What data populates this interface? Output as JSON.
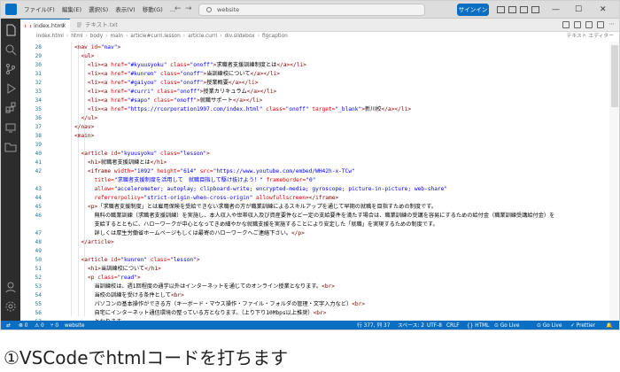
{
  "titlebar": {
    "menu": [
      "ファイル(F)",
      "編集(E)",
      "選択(S)",
      "表示(V)",
      "移動(G)",
      "…"
    ],
    "search_text": "website",
    "signin_label": "サインイン",
    "back_glyph": "←",
    "forward_glyph": "→",
    "minimize_glyph": "—",
    "maximize_glyph": "☐",
    "close_glyph": "✕"
  },
  "tabs": [
    {
      "label": "index.html",
      "close": "×",
      "active": true
    },
    {
      "label": "テキスト.txt",
      "active": false
    }
  ],
  "breadcrumb": {
    "items": [
      "index.html",
      "html",
      "body",
      "main",
      "article#curri.lesson",
      "article.curri",
      "div.slidebox",
      "figcaption"
    ],
    "right_label": "テキスト エディター"
  },
  "code_lines": [
    {
      "n": "28",
      "indent": 4,
      "segs": [
        [
          "tag",
          "<nav "
        ],
        [
          "attr",
          "id="
        ],
        [
          "val",
          "\"nav\""
        ],
        [
          "tag",
          ">"
        ]
      ]
    },
    {
      "n": "29",
      "indent": 6,
      "segs": [
        [
          "tag",
          "<ul>"
        ]
      ]
    },
    {
      "n": "30",
      "indent": 8,
      "segs": [
        [
          "tag",
          "<li><a "
        ],
        [
          "attr",
          "href="
        ],
        [
          "val",
          "\"#kyuusyoku\""
        ],
        [
          "attr",
          " class="
        ],
        [
          "val",
          "\"onoff\""
        ],
        [
          "tag",
          ">"
        ],
        [
          "txt",
          "求職者支援訓練制度とは"
        ],
        [
          "tag",
          "</a></li>"
        ]
      ]
    },
    {
      "n": "31",
      "indent": 8,
      "segs": [
        [
          "tag",
          "<li><a "
        ],
        [
          "attr",
          "href="
        ],
        [
          "val",
          "\"#kunren\""
        ],
        [
          "attr",
          " class="
        ],
        [
          "val",
          "\"onoff\""
        ],
        [
          "tag",
          ">"
        ],
        [
          "txt",
          "当訓練校について"
        ],
        [
          "tag",
          "</a></li>"
        ]
      ]
    },
    {
      "n": "32",
      "indent": 8,
      "segs": [
        [
          "tag",
          "<li><a "
        ],
        [
          "attr",
          "href="
        ],
        [
          "val",
          "\"#gaiyou\""
        ],
        [
          "attr",
          " class="
        ],
        [
          "val",
          "\"onoff\""
        ],
        [
          "tag",
          ">"
        ],
        [
          "txt",
          "授業概要"
        ],
        [
          "tag",
          "</a></li>"
        ]
      ]
    },
    {
      "n": "33",
      "indent": 8,
      "segs": [
        [
          "tag",
          "<li><a "
        ],
        [
          "attr",
          "href="
        ],
        [
          "val",
          "\"#curri\""
        ],
        [
          "attr",
          " class="
        ],
        [
          "val",
          "\"onoff\""
        ],
        [
          "tag",
          ">"
        ],
        [
          "txt",
          "授業カリキュラム"
        ],
        [
          "tag",
          "</a></li>"
        ]
      ]
    },
    {
      "n": "34",
      "indent": 8,
      "segs": [
        [
          "tag",
          "<li><a "
        ],
        [
          "attr",
          "href="
        ],
        [
          "val",
          "\"#sapo\""
        ],
        [
          "attr",
          " class="
        ],
        [
          "val",
          "\"onoff\""
        ],
        [
          "tag",
          ">"
        ],
        [
          "txt",
          "就職サポート"
        ],
        [
          "tag",
          "</a></li>"
        ]
      ]
    },
    {
      "n": "35",
      "indent": 8,
      "segs": [
        [
          "tag",
          "<li><a "
        ],
        [
          "attr",
          "href="
        ],
        [
          "val",
          "\"https://rcorporation1997.com/index.html\""
        ],
        [
          "attr",
          " class="
        ],
        [
          "val",
          "\"onoff\""
        ],
        [
          "attr",
          " target="
        ],
        [
          "val",
          "\"_blank\""
        ],
        [
          "tag",
          ">"
        ],
        [
          "txt",
          "新川校"
        ],
        [
          "tag",
          "</a></li>"
        ]
      ]
    },
    {
      "n": "36",
      "indent": 6,
      "segs": [
        [
          "tag",
          "</ul>"
        ]
      ]
    },
    {
      "n": "37",
      "indent": 4,
      "segs": [
        [
          "tag",
          "</nav>"
        ]
      ]
    },
    {
      "n": "38",
      "indent": 4,
      "segs": [
        [
          "tag",
          "<main>"
        ]
      ]
    },
    {
      "n": "39",
      "indent": 0,
      "segs": []
    },
    {
      "n": "40",
      "indent": 6,
      "segs": [
        [
          "tag",
          "<article "
        ],
        [
          "attr",
          "id="
        ],
        [
          "val",
          "\"kyuusyoku\""
        ],
        [
          "attr",
          " class="
        ],
        [
          "val",
          "\"lesson\""
        ],
        [
          "tag",
          ">"
        ]
      ]
    },
    {
      "n": "41",
      "indent": 8,
      "segs": [
        [
          "tag",
          "<h1>"
        ],
        [
          "txt",
          "就職者支援訓練とは"
        ],
        [
          "tag",
          "</h1>"
        ]
      ]
    },
    {
      "n": "42",
      "indent": 8,
      "segs": [
        [
          "tag",
          "<iframe "
        ],
        [
          "attr",
          "width="
        ],
        [
          "val",
          "\"1092\""
        ],
        [
          "attr",
          " height="
        ],
        [
          "val",
          "\"614\""
        ],
        [
          "attr",
          " src="
        ],
        [
          "val",
          "\"https://www.youtube.com/embed/WH42h-x-TCw\""
        ]
      ]
    },
    {
      "n": "",
      "indent": 10,
      "segs": [
        [
          "attr",
          "title="
        ],
        [
          "val",
          "\"求職者支援制度を活用して　就職目指して駆け抜けよう！\""
        ],
        [
          "attr",
          " frameborder="
        ],
        [
          "val",
          "\"0\""
        ]
      ]
    },
    {
      "n": "43",
      "indent": 10,
      "segs": [
        [
          "attr",
          "allow="
        ],
        [
          "val",
          "\"accelerometer; autoplay; clipboard-write; encrypted-media; gyroscope; picture-in-picture; web-share\""
        ]
      ]
    },
    {
      "n": "44",
      "indent": 10,
      "segs": [
        [
          "attr",
          "referrerpolicy="
        ],
        [
          "val",
          "\"strict-origin-when-cross-origin\""
        ],
        [
          "attr",
          " allowfullscreen"
        ],
        [
          "tag",
          "></iframe>"
        ]
      ]
    },
    {
      "n": "45",
      "indent": 8,
      "segs": [
        [
          "tag",
          "<p>"
        ],
        [
          "txt",
          "「求職者支援制度」とは雇用保険を受給できない求職者の方が職業訓練によるスキルアップを通じて早期の就職を目指すための制度です。"
        ]
      ]
    },
    {
      "n": "46",
      "indent": 10,
      "segs": [
        [
          "txt",
          "無料の職業訓練（求職者支援訓練）を実施し、本人収入や世帯収入及び資産要件など一定の支給要件を満たす場合は、職業訓練の受講を容易にするための給付金（職業訓練受講給付金）を"
        ]
      ]
    },
    {
      "n": "",
      "indent": 10,
      "segs": [
        [
          "txt",
          "支給するとともに、ハローワークが中心となってきめ細やかな就職支援を実施することにより安定した「就職」を実現するための制度です。"
        ]
      ]
    },
    {
      "n": "47",
      "indent": 10,
      "segs": [
        [
          "txt",
          "詳しくは厚生労働省ホームページもしくは最寄のハローワークへご連絡下さい。"
        ],
        [
          "tag",
          "</p>"
        ]
      ]
    },
    {
      "n": "48",
      "indent": 6,
      "segs": [
        [
          "tag",
          "</article>"
        ]
      ]
    },
    {
      "n": "49",
      "indent": 0,
      "segs": []
    },
    {
      "n": "50",
      "indent": 6,
      "segs": [
        [
          "tag",
          "<article "
        ],
        [
          "attr",
          "id="
        ],
        [
          "val",
          "\"kunren\""
        ],
        [
          "attr",
          " class="
        ],
        [
          "val",
          "\"lesson\""
        ],
        [
          "tag",
          ">"
        ]
      ]
    },
    {
      "n": "51",
      "indent": 8,
      "segs": [
        [
          "tag",
          "<h1>"
        ],
        [
          "txt",
          "当訓練校について"
        ],
        [
          "tag",
          "</h1>"
        ]
      ]
    },
    {
      "n": "52",
      "indent": 8,
      "segs": [
        [
          "tag",
          "<p "
        ],
        [
          "attr",
          "class="
        ],
        [
          "val",
          "\"read\""
        ],
        [
          "tag",
          ">"
        ]
      ]
    },
    {
      "n": "53",
      "indent": 10,
      "segs": [
        [
          "txt",
          "当訓練校は、週1回程度の通学以外はインターネットを通じてのオンライン授業となります。"
        ],
        [
          "tag",
          "<br>"
        ]
      ]
    },
    {
      "n": "54",
      "indent": 10,
      "segs": [
        [
          "txt",
          "当校の訓練を受ける条件として"
        ],
        [
          "tag",
          "<br>"
        ]
      ]
    },
    {
      "n": "55",
      "indent": 10,
      "segs": [
        [
          "txt",
          "パソコンの基本操作ができる方（キーボード・マウス操作・ファイル・フォルダの管理・文字入力など）"
        ],
        [
          "tag",
          "<br>"
        ]
      ]
    },
    {
      "n": "56",
      "indent": 10,
      "segs": [
        [
          "txt",
          "自宅にインターネット通信環境の整っている方となります。（上り下り10Mbps以上推奨）"
        ],
        [
          "tag",
          "<br>"
        ]
      ]
    },
    {
      "n": "57",
      "indent": 10,
      "segs": [
        [
          "txt",
          "となります。"
        ]
      ]
    }
  ],
  "statusbar": {
    "remote": "⇄",
    "errors": "⊗ 0",
    "warnings": "⚠ 0",
    "ports": "⑂ 0",
    "folder": "website",
    "position": "行 377, 列 37",
    "spaces": "スペース: 2",
    "encoding": "UTF-8",
    "eol": "CRLF",
    "language": "{} HTML",
    "golive1": "⊙ Go Live",
    "golive2": "⊙ Go Live",
    "prettier": "✓ Prettier",
    "bell": "🔔"
  },
  "caption": "①VSCodeでhtmlコードを打ちます"
}
